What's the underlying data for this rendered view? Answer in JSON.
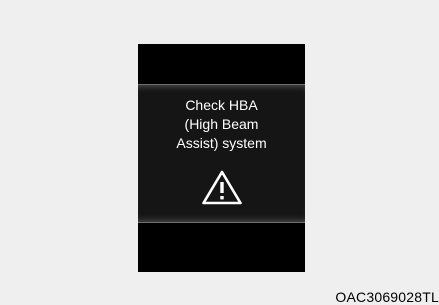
{
  "display": {
    "message_lines": [
      "Check HBA",
      "(High Beam",
      "Assist) system"
    ],
    "icon": "warning-triangle-icon"
  },
  "image_code": "OAC3069028TL",
  "colors": {
    "page_background": "#efefef",
    "panel_background": "#000000",
    "display_band": "#151515",
    "text": "#ffffff"
  }
}
